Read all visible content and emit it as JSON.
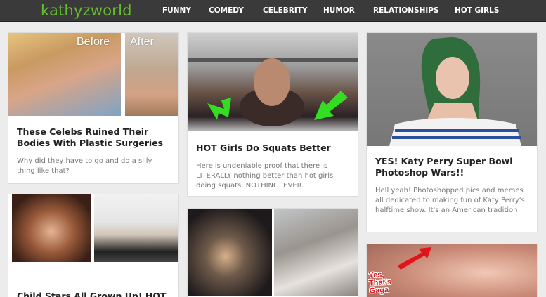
{
  "site": {
    "logo": "kathyzworld"
  },
  "nav": [
    "FUNNY",
    "COMEDY",
    "CELEBRITY",
    "HUMOR",
    "RELATIONSHIPS",
    "HOT GIRLS"
  ],
  "cards": {
    "celebs": {
      "title": "These Celebs Ruined Their Bodies With Plastic Surgeries",
      "desc": "Why did they have to go and do a silly thing like that?",
      "before_label": "Before",
      "after_label": "After"
    },
    "squats": {
      "title": "HOT Girls Do Squats Better",
      "desc": "Here is undeniable proof that there is LITERALLY nothing better than hot girls doing squats. NOTHING. EVER."
    },
    "katy": {
      "title": "YES! Katy Perry Super Bowl Photoshop Wars!!",
      "desc": "Hell yeah! Photoshopped pics and memes all dedicated to making fun of Katy Perry's halftime show. It's an American tradition!"
    },
    "child": {
      "title": "Child Stars All Grown Up! HOT"
    },
    "pics": {},
    "gaga": {
      "caption": "Yes, That's Gaga"
    }
  },
  "colors": {
    "topbar": "#3a3a3a",
    "logo": "#63c02a",
    "arrow_green": "#33dd22",
    "arrow_red": "#e0151b"
  }
}
